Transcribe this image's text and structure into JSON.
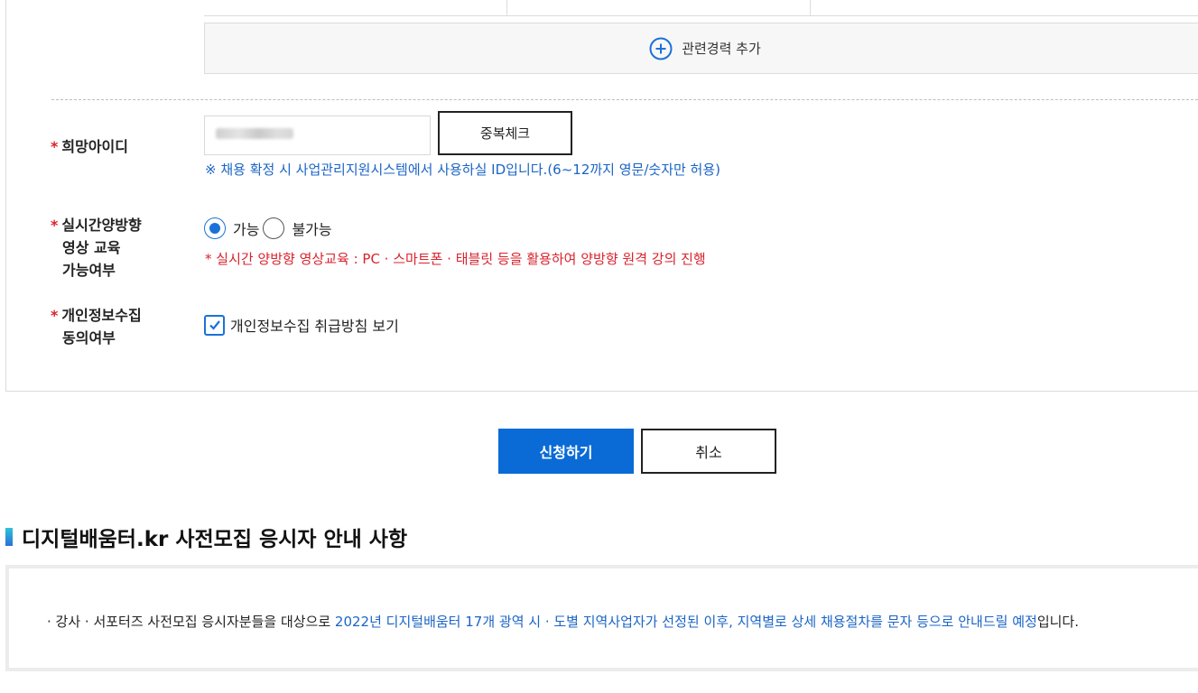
{
  "career": {
    "add_label": "관련경력 추가",
    "add_icon": "plus-circle-icon"
  },
  "fields": {
    "desired_id": {
      "required_mark": "*",
      "label": "희망아이디",
      "placeholder": "",
      "dup_check_label": "중복체크",
      "help": "※ 채용 확정 시 사업관리지원시스템에서 사용하실 ID입니다.(6~12까지 영문/숫자만 허용)"
    },
    "video_class": {
      "required_mark": "*",
      "label_line1": "실시간양방향",
      "label_line2": "영상 교육",
      "label_line3": "가능여부",
      "options": [
        "가능",
        "불가능"
      ],
      "selected": "가능",
      "help": "* 실시간 양방향 영상교육 : PC · 스마트폰 · 태블릿 등을 활용하여 양방향 원격 강의 진행"
    },
    "privacy": {
      "required_mark": "*",
      "label_line1": "개인정보수집",
      "label_line2": "동의여부",
      "checkbox_label": "개인정보수집 취급방침 보기",
      "checked": true
    }
  },
  "actions": {
    "submit_label": "신청하기",
    "cancel_label": "취소"
  },
  "notice": {
    "title": "디지털배움터.kr 사전모집 응시자 안내 사항",
    "text_prefix": "· 강사  · 서포터즈 사전모집 응시자분들을 대상으로 ",
    "text_highlight": "2022년 디지털배움터 17개 광역 시 · 도별 지역사업자가 선정된 이후, 지역별로 상세 채용절차를 문자 등으로 안내드릴 예정",
    "text_suffix": "입니다."
  },
  "colors": {
    "primary": "#0a6bd6",
    "link_blue": "#1b64c5",
    "required_red": "#d9232d"
  }
}
